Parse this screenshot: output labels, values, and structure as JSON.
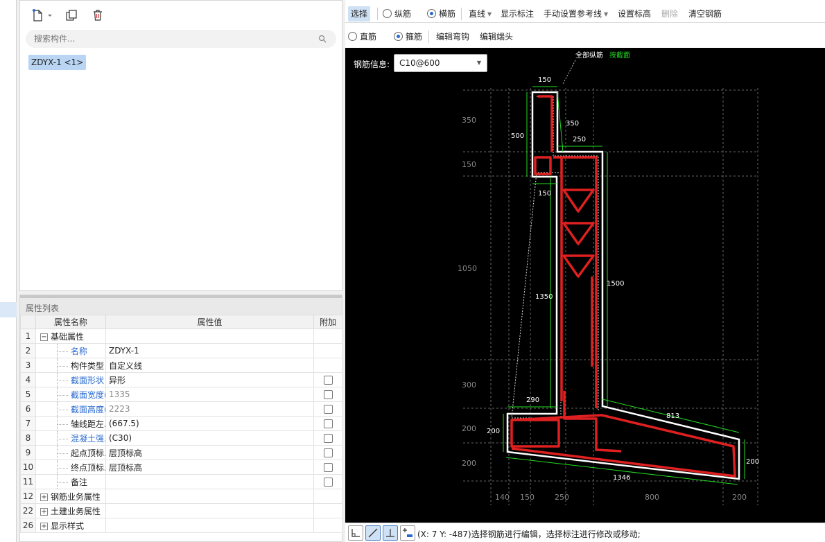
{
  "component_panel": {
    "search_placeholder": "搜索构件...",
    "component_chip": "ZDYX-1 <1>",
    "icons": [
      "new-file-icon",
      "copy-icon",
      "trash-icon",
      "search-icon"
    ]
  },
  "properties": {
    "title": "属性列表",
    "columns": [
      "属性名称",
      "属性值",
      "附加"
    ],
    "rows": [
      {
        "num": "1",
        "name": "基础属性",
        "value": "",
        "expand": "−",
        "style": "group",
        "checkbox": false
      },
      {
        "num": "2",
        "name": "名称",
        "value": "ZDYX-1",
        "style": "blue",
        "checkbox": false
      },
      {
        "num": "3",
        "name": "构件类型",
        "value": "自定义线",
        "style": "black",
        "checkbox": false
      },
      {
        "num": "4",
        "name": "截面形状",
        "value": "异形",
        "style": "blue",
        "checkbox": true
      },
      {
        "num": "5",
        "name": "截面宽度(...",
        "value": "1335",
        "style": "blue",
        "value_gray": true,
        "checkbox": true
      },
      {
        "num": "6",
        "name": "截面高度(...",
        "value": "2223",
        "style": "blue",
        "value_gray": true,
        "checkbox": true
      },
      {
        "num": "7",
        "name": "轴线距左...",
        "value": "(667.5)",
        "style": "black",
        "checkbox": true
      },
      {
        "num": "8",
        "name": "混凝土强...",
        "value": "(C30)",
        "style": "blue",
        "checkbox": true
      },
      {
        "num": "9",
        "name": "起点顶标...",
        "value": "层顶标高",
        "style": "black",
        "checkbox": true
      },
      {
        "num": "10",
        "name": "终点顶标...",
        "value": "层顶标高",
        "style": "black",
        "checkbox": true
      },
      {
        "num": "11",
        "name": "备注",
        "value": "",
        "style": "black",
        "checkbox": true
      },
      {
        "num": "12",
        "name": "钢筋业务属性",
        "value": "",
        "expand": "+",
        "style": "group",
        "checkbox": false
      },
      {
        "num": "22",
        "name": "土建业务属性",
        "value": "",
        "expand": "+",
        "style": "group",
        "checkbox": false
      },
      {
        "num": "26",
        "name": "显示样式",
        "value": "",
        "expand": "+",
        "style": "group",
        "checkbox": false
      }
    ]
  },
  "toolbar1": {
    "select": "选择",
    "longitudinal": "纵筋",
    "transverse": "横筋",
    "line": "直线",
    "show_annotation": "显示标注",
    "manual_ref": "手动设置参考线",
    "set_elevation": "设置标高",
    "delete": "删除",
    "clear_rebar": "清空钢筋"
  },
  "toolbar2": {
    "straight": "直筋",
    "stirrup": "箍筋",
    "edit_hook": "编辑弯钩",
    "edit_end": "编辑端头"
  },
  "canvas": {
    "rebar_info_label": "钢筋信息:",
    "rebar_info_value": "C10@600",
    "note_all": "全部纵筋",
    "note_section": "按截面",
    "dims": {
      "d150_top": "150",
      "d350_right": "350",
      "d500": "500",
      "d250": "250",
      "d150_mid": "150",
      "d1350": "1350",
      "d1500": "1500",
      "d290": "290",
      "d813": "813",
      "d200_left": "200",
      "d200_right": "200",
      "d1346": "1346"
    },
    "left_axis": [
      "350",
      "150",
      "1050",
      "300",
      "200",
      "200"
    ],
    "bottom_axis": [
      "140",
      "150",
      "250",
      "800",
      "200"
    ],
    "colors": {
      "background": "#000000",
      "rebar": "#e02020",
      "outline": "#ffffff",
      "dimension": "#22dd22",
      "axis": "#777777"
    }
  },
  "status": {
    "message": "(X: 7 Y: -487)选择钢筋进行编辑，选择标注进行修改或移动;"
  }
}
